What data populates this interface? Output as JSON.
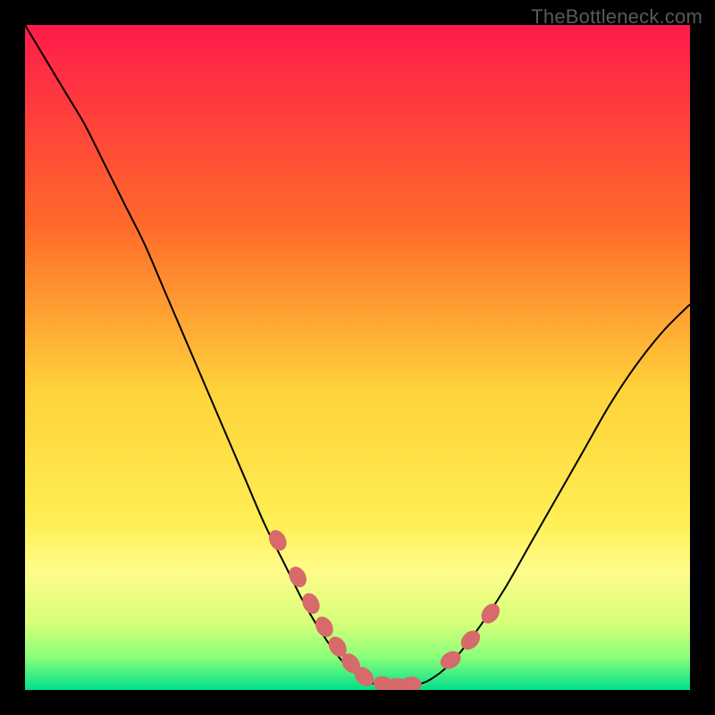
{
  "watermark": "TheBottleneck.com",
  "chart_data": {
    "type": "line",
    "title": "",
    "xlabel": "",
    "ylabel": "",
    "xlim": [
      0,
      100
    ],
    "ylim": [
      0,
      100
    ],
    "grid": false,
    "legend": false,
    "background_gradient_stops": [
      {
        "offset": 0,
        "color": "#ff1b4b"
      },
      {
        "offset": 0.3,
        "color": "#ff6a2a"
      },
      {
        "offset": 0.55,
        "color": "#ffd23a"
      },
      {
        "offset": 0.75,
        "color": "#ffef55"
      },
      {
        "offset": 0.82,
        "color": "#fffc8a"
      },
      {
        "offset": 0.9,
        "color": "#d6ff7a"
      },
      {
        "offset": 0.95,
        "color": "#8bff7a"
      },
      {
        "offset": 1.0,
        "color": "#00e08a"
      }
    ],
    "series": [
      {
        "name": "curve",
        "type": "line",
        "color": "#000000",
        "x": [
          0,
          3,
          6,
          9,
          12,
          15,
          18,
          21,
          24,
          27,
          30,
          33,
          36,
          39,
          42,
          45,
          48,
          51,
          53,
          55,
          57,
          59,
          61,
          64,
          68,
          72,
          76,
          80,
          84,
          88,
          92,
          96,
          100
        ],
        "y": [
          100,
          95,
          90,
          85,
          79,
          73,
          67,
          60,
          53,
          46,
          39,
          32,
          25,
          19,
          13,
          8,
          4,
          1.6,
          0.8,
          0.4,
          0.4,
          0.8,
          1.6,
          4,
          9,
          15,
          22,
          29,
          36,
          43,
          49,
          54,
          58
        ]
      },
      {
        "name": "markers",
        "type": "scatter",
        "marker_color": "#d76a6a",
        "marker_radius": 9,
        "x": [
          38,
          41,
          43,
          45,
          47,
          49,
          51,
          54,
          56,
          58,
          64,
          67,
          70
        ],
        "y": [
          22.5,
          17,
          13,
          9.5,
          6.5,
          4,
          2,
          0.8,
          0.6,
          0.8,
          4.5,
          7.5,
          11.5
        ]
      }
    ]
  }
}
